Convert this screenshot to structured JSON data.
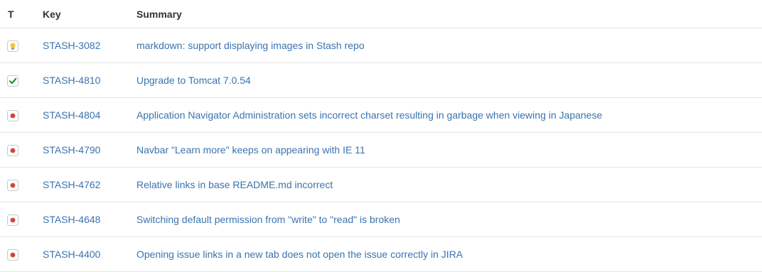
{
  "header": {
    "type": "T",
    "key": "Key",
    "summary": "Summary"
  },
  "colors": {
    "link": "#3b73af",
    "bug": "#d04437",
    "improvement": "#f6c342",
    "task": "#14892c"
  },
  "rows": [
    {
      "type": "improvement-icon",
      "key": "STASH-3082",
      "summary": "markdown: support displaying images in Stash repo"
    },
    {
      "type": "task-icon",
      "key": "STASH-4810",
      "summary": "Upgrade to Tomcat 7.0.54"
    },
    {
      "type": "bug-icon",
      "key": "STASH-4804",
      "summary": "Application Navigator Administration sets incorrect charset resulting in garbage when viewing in Japanese"
    },
    {
      "type": "bug-icon",
      "key": "STASH-4790",
      "summary": "Navbar \"Learn more\" keeps on appearing with IE 11"
    },
    {
      "type": "bug-icon",
      "key": "STASH-4762",
      "summary": "Relative links in base README.md incorrect"
    },
    {
      "type": "bug-icon",
      "key": "STASH-4648",
      "summary": "Switching default permission from \"write\" to \"read\" is broken"
    },
    {
      "type": "bug-icon",
      "key": "STASH-4400",
      "summary": "Opening issue links in a new tab does not open the issue correctly in JIRA"
    }
  ]
}
